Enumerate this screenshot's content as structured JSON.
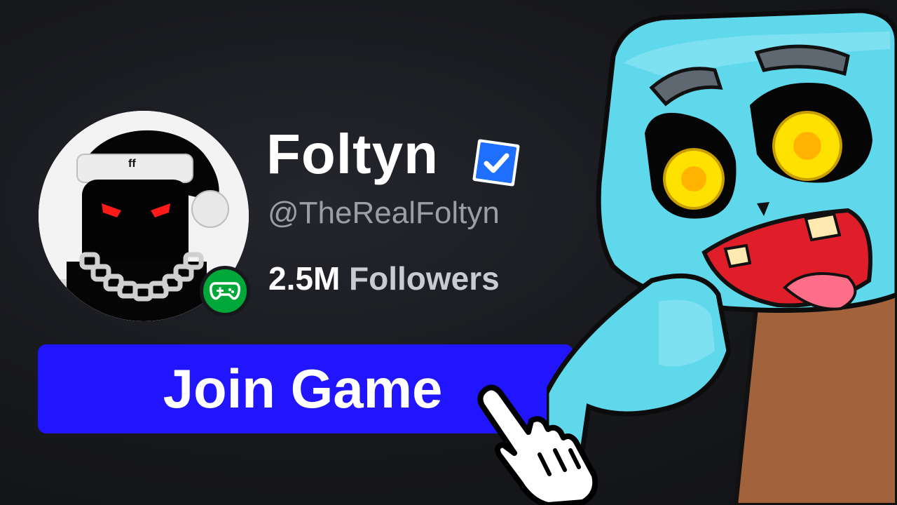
{
  "profile": {
    "display_name": "Foltyn",
    "handle": "@TheRealFoltyn",
    "followers_count": "2.5M",
    "followers_label": "Followers",
    "verified_icon": "verified-check-icon",
    "presence_icon": "gamepad-icon",
    "presence_color": "#00a83a"
  },
  "action": {
    "join_label": "Join Game",
    "button_color": "#2114ff"
  },
  "illustration": {
    "mascot": "cyan-robot-mascot",
    "cursor_icon": "hand-pointer-cursor-icon"
  }
}
